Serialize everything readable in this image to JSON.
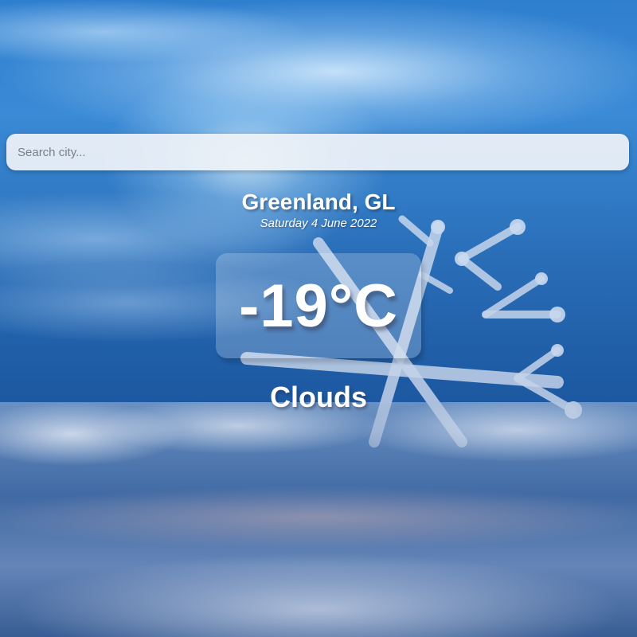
{
  "search": {
    "placeholder": "Search city...",
    "value": ""
  },
  "location": {
    "city": "Greenland, GL",
    "date": "Saturday 4 June 2022"
  },
  "current": {
    "temperature": "-19°C",
    "condition": "Clouds"
  },
  "background": {
    "icon": "snowflake-illustration",
    "sky_color": "#2a6fb8"
  }
}
